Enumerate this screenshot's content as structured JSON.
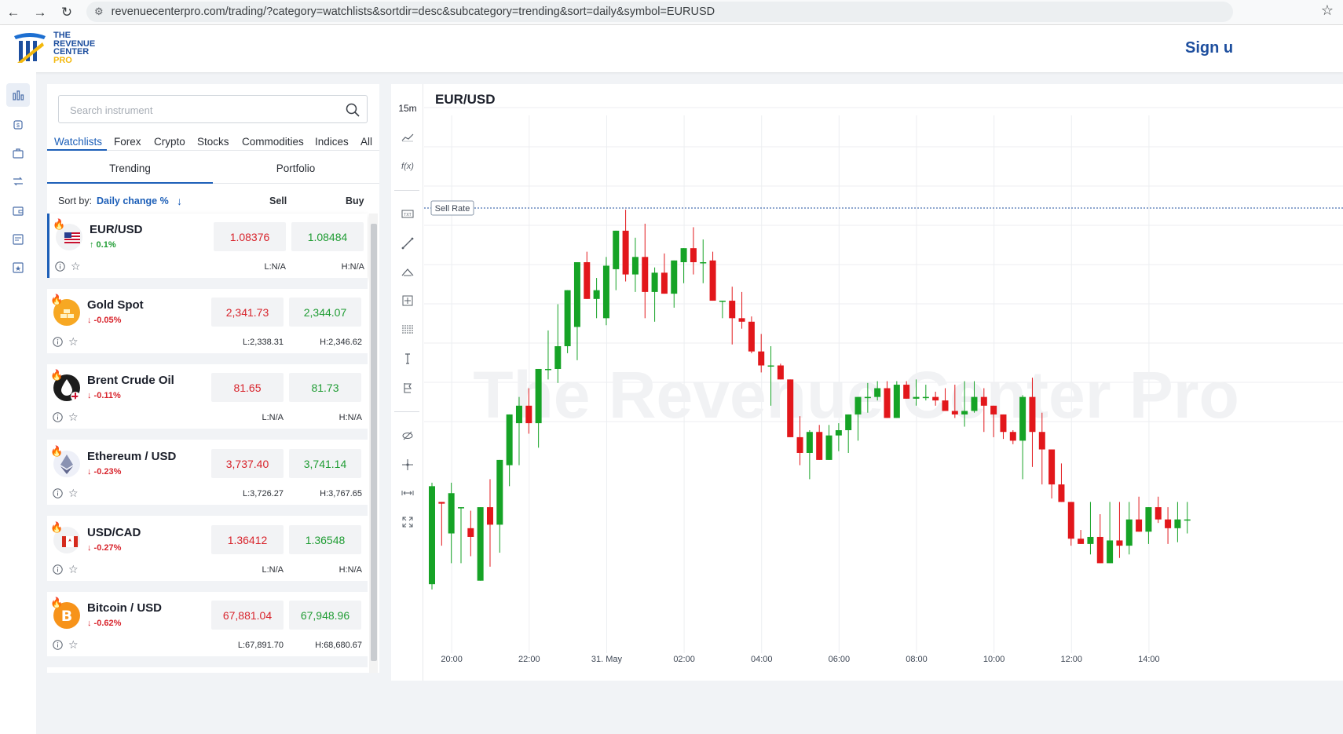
{
  "browser": {
    "url": "revenuecenterpro.com/trading/?category=watchlists&sortdir=desc&subcategory=trending&sort=daily&symbol=EURUSD"
  },
  "header": {
    "logo_lines": [
      "THE",
      "REVENUE",
      "CENTER",
      "PRO"
    ],
    "sign_in": "Sign u"
  },
  "rail": {
    "icons": [
      "chart-bars-icon",
      "money-bag-icon",
      "briefcase-icon",
      "transfer-icon",
      "wallet-icon",
      "news-icon",
      "star-box-icon"
    ]
  },
  "panel": {
    "search_placeholder": "Search instrument",
    "category_tabs": [
      "Watchlists",
      "Forex",
      "Crypto",
      "Stocks",
      "Commodities",
      "Indices",
      "All"
    ],
    "active_category": "Watchlists",
    "sub_tabs": [
      "Trending",
      "Portfolio"
    ],
    "active_sub_tab": "Trending",
    "sort_label": "Sort by:",
    "sort_value": "Daily change %",
    "sort_arrow": "↓",
    "sell_header": "Sell",
    "buy_header": "Buy",
    "instruments": [
      {
        "name": "EUR/USD",
        "change": "↑ 0.1%",
        "direction": "up",
        "sell": "1.08376",
        "buy": "1.08484",
        "low": "L:N/A",
        "high": "H:N/A",
        "icon": "eur-usd-flag-icon",
        "active": true
      },
      {
        "name": "Gold Spot",
        "change": "↓ -0.05%",
        "direction": "down",
        "sell": "2,341.73",
        "buy": "2,344.07",
        "low": "L:2,338.31",
        "high": "H:2,346.62",
        "icon": "gold-bars-icon",
        "active": false
      },
      {
        "name": "Brent Crude Oil",
        "change": "↓ -0.11%",
        "direction": "down",
        "sell": "81.65",
        "buy": "81.73",
        "low": "L:N/A",
        "high": "H:N/A",
        "icon": "oil-drop-icon",
        "active": false
      },
      {
        "name": "Ethereum / USD",
        "change": "↓ -0.23%",
        "direction": "down",
        "sell": "3,737.40",
        "buy": "3,741.14",
        "low": "L:3,726.27",
        "high": "H:3,767.65",
        "icon": "ethereum-icon",
        "active": false
      },
      {
        "name": "USD/CAD",
        "change": "↓ -0.27%",
        "direction": "down",
        "sell": "1.36412",
        "buy": "1.36548",
        "low": "L:N/A",
        "high": "H:N/A",
        "icon": "usd-cad-flag-icon",
        "active": false
      },
      {
        "name": "Bitcoin / USD",
        "change": "↓ -0.62%",
        "direction": "down",
        "sell": "67,881.04",
        "buy": "67,948.96",
        "low": "L:67,891.70",
        "high": "H:68,680.67",
        "icon": "bitcoin-icon",
        "active": false
      }
    ]
  },
  "chart": {
    "interval": "15m",
    "symbol": "EUR/USD",
    "sell_rate_label": "Sell Rate",
    "watermark": "The Revenue Center Pro",
    "tools": [
      "line-type-icon",
      "fx-indicator-icon",
      "text-tool-icon",
      "trend-line-icon",
      "channel-tool-icon",
      "crosshair-box-icon",
      "fibonacci-icon",
      "vertical-line-icon",
      "flag-tool-icon",
      "hide-icon",
      "cursor-icon",
      "measure-icon",
      "fullscreen-icon"
    ],
    "x_ticks": [
      "20:00",
      "22:00",
      "31. May",
      "02:00",
      "04:00",
      "06:00",
      "08:00",
      "10:00",
      "12:00",
      "14:00"
    ],
    "colors": {
      "up": "#16a326",
      "down": "#e2171b",
      "grid": "#eceef1",
      "accent": "#1d5fb8"
    }
  },
  "chart_data": {
    "type": "candlestick",
    "title": "EUR/USD",
    "x": [
      "19:30",
      "19:45",
      "20:00",
      "20:15",
      "20:30",
      "20:45",
      "21:00",
      "21:15",
      "21:30",
      "21:45",
      "22:00",
      "22:15",
      "22:30",
      "22:45",
      "23:00",
      "23:15",
      "23:30",
      "23:45",
      "00:00",
      "00:15",
      "00:30",
      "00:45",
      "01:00",
      "01:15",
      "01:30",
      "01:45",
      "02:00",
      "02:15",
      "02:30",
      "02:45",
      "03:00",
      "03:15",
      "03:30",
      "03:45",
      "04:00",
      "04:15",
      "04:30",
      "04:45",
      "05:00",
      "05:15",
      "05:30",
      "05:45",
      "06:00",
      "06:15",
      "06:30",
      "06:45",
      "07:00",
      "07:15",
      "07:30",
      "07:45",
      "08:00",
      "08:15",
      "08:30",
      "08:45",
      "09:00",
      "09:15",
      "09:30",
      "09:45",
      "10:00",
      "10:15",
      "10:30",
      "10:45",
      "11:00",
      "11:15",
      "11:30",
      "11:45",
      "12:00",
      "12:15",
      "12:30",
      "12:45",
      "13:00",
      "13:15",
      "13:30",
      "13:45",
      "14:00",
      "14:15",
      "14:30",
      "14:45",
      "15:00"
    ],
    "candles": [
      {
        "o": 8,
        "h": 66,
        "l": 5,
        "c": 64
      },
      {
        "o": 55,
        "h": 54,
        "l": 30,
        "c": 54
      },
      {
        "o": 37,
        "h": 66,
        "l": 20,
        "c": 60
      },
      {
        "o": 52,
        "h": 47,
        "l": 20,
        "c": 52
      },
      {
        "o": 40,
        "h": 50,
        "l": 24,
        "c": 35
      },
      {
        "o": 10,
        "h": 44,
        "l": 18,
        "c": 52
      },
      {
        "o": 52,
        "h": 68,
        "l": 18,
        "c": 42
      },
      {
        "o": 42,
        "h": 71,
        "l": 26,
        "c": 79
      },
      {
        "o": 76,
        "h": 100,
        "l": 64,
        "c": 105
      },
      {
        "o": 100,
        "h": 115,
        "l": 76,
        "c": 110
      },
      {
        "o": 110,
        "h": 120,
        "l": 94,
        "c": 100
      },
      {
        "o": 100,
        "h": 131,
        "l": 86,
        "c": 131
      },
      {
        "o": 131,
        "h": 153,
        "l": 125,
        "c": 131
      },
      {
        "o": 131,
        "h": 168,
        "l": 123,
        "c": 144
      },
      {
        "o": 144,
        "h": 172,
        "l": 140,
        "c": 176
      },
      {
        "o": 155,
        "h": 176,
        "l": 136,
        "c": 192
      },
      {
        "o": 192,
        "h": 198,
        "l": 180,
        "c": 171
      },
      {
        "o": 171,
        "h": 183,
        "l": 160,
        "c": 176
      },
      {
        "o": 160,
        "h": 195,
        "l": 156,
        "c": 190
      },
      {
        "o": 188,
        "h": 200,
        "l": 176,
        "c": 210
      },
      {
        "o": 210,
        "h": 222,
        "l": 181,
        "c": 185
      },
      {
        "o": 185,
        "h": 206,
        "l": 175,
        "c": 195
      },
      {
        "o": 195,
        "h": 214,
        "l": 160,
        "c": 175
      },
      {
        "o": 175,
        "h": 189,
        "l": 158,
        "c": 186
      },
      {
        "o": 186,
        "h": 197,
        "l": 174,
        "c": 174
      },
      {
        "o": 174,
        "h": 183,
        "l": 166,
        "c": 193
      },
      {
        "o": 192,
        "h": 200,
        "l": 180,
        "c": 200
      },
      {
        "o": 200,
        "h": 212,
        "l": 185,
        "c": 192
      },
      {
        "o": 192,
        "h": 205,
        "l": 180,
        "c": 192
      },
      {
        "o": 193,
        "h": 198,
        "l": 172,
        "c": 170
      },
      {
        "o": 170,
        "h": 170,
        "l": 160,
        "c": 170
      },
      {
        "o": 170,
        "h": 178,
        "l": 145,
        "c": 160
      },
      {
        "o": 160,
        "h": 175,
        "l": 154,
        "c": 158
      },
      {
        "o": 158,
        "h": 161,
        "l": 140,
        "c": 141
      },
      {
        "o": 141,
        "h": 151,
        "l": 129,
        "c": 133
      },
      {
        "o": 133,
        "h": 144,
        "l": 110,
        "c": 133
      },
      {
        "o": 133,
        "h": 134,
        "l": 126,
        "c": 125
      },
      {
        "o": 125,
        "h": 105,
        "l": 100,
        "c": 92
      },
      {
        "o": 92,
        "h": 104,
        "l": 76,
        "c": 83
      },
      {
        "o": 83,
        "h": 96,
        "l": 68,
        "c": 95
      },
      {
        "o": 95,
        "h": 99,
        "l": 83,
        "c": 79
      },
      {
        "o": 79,
        "h": 99,
        "l": 81,
        "c": 93
      },
      {
        "o": 93,
        "h": 100,
        "l": 84,
        "c": 96
      },
      {
        "o": 96,
        "h": 104,
        "l": 83,
        "c": 105
      },
      {
        "o": 105,
        "h": 115,
        "l": 90,
        "c": 115
      },
      {
        "o": 115,
        "h": 123,
        "l": 106,
        "c": 115
      },
      {
        "o": 115,
        "h": 124,
        "l": 113,
        "c": 120
      },
      {
        "o": 120,
        "h": 124,
        "l": 106,
        "c": 103
      },
      {
        "o": 103,
        "h": 124,
        "l": 108,
        "c": 122
      },
      {
        "o": 122,
        "h": 124,
        "l": 116,
        "c": 114
      },
      {
        "o": 114,
        "h": 125,
        "l": 110,
        "c": 115
      },
      {
        "o": 115,
        "h": 122,
        "l": 113,
        "c": 115
      },
      {
        "o": 115,
        "h": 118,
        "l": 110,
        "c": 113
      },
      {
        "o": 113,
        "h": 120,
        "l": 109,
        "c": 107
      },
      {
        "o": 107,
        "h": 122,
        "l": 103,
        "c": 105
      },
      {
        "o": 105,
        "h": 124,
        "l": 98,
        "c": 107
      },
      {
        "o": 107,
        "h": 124,
        "l": 106,
        "c": 115
      },
      {
        "o": 115,
        "h": 120,
        "l": 95,
        "c": 110
      },
      {
        "o": 110,
        "h": 107,
        "l": 92,
        "c": 105
      },
      {
        "o": 105,
        "h": 97,
        "l": 91,
        "c": 95
      },
      {
        "o": 95,
        "h": 96,
        "l": 88,
        "c": 90
      },
      {
        "o": 90,
        "h": 116,
        "l": 68,
        "c": 115
      },
      {
        "o": 115,
        "h": 126,
        "l": 75,
        "c": 95
      },
      {
        "o": 95,
        "h": 106,
        "l": 65,
        "c": 85
      },
      {
        "o": 85,
        "h": 70,
        "l": 57,
        "c": 65
      },
      {
        "o": 65,
        "h": 77,
        "l": 55,
        "c": 55
      },
      {
        "o": 55,
        "h": 42,
        "l": 30,
        "c": 34
      },
      {
        "o": 34,
        "h": 39,
        "l": 31,
        "c": 31
      },
      {
        "o": 31,
        "h": 55,
        "l": 25,
        "c": 35
      },
      {
        "o": 35,
        "h": 48,
        "l": 20,
        "c": 20
      },
      {
        "o": 20,
        "h": 55,
        "l": 25,
        "c": 33
      },
      {
        "o": 33,
        "h": 55,
        "l": 23,
        "c": 30
      },
      {
        "o": 30,
        "h": 55,
        "l": 25,
        "c": 45
      },
      {
        "o": 45,
        "h": 58,
        "l": 39,
        "c": 38
      },
      {
        "o": 38,
        "h": 52,
        "l": 31,
        "c": 52
      },
      {
        "o": 52,
        "h": 58,
        "l": 43,
        "c": 45
      },
      {
        "o": 45,
        "h": 52,
        "l": 31,
        "c": 40
      },
      {
        "o": 40,
        "h": 55,
        "l": 32,
        "c": 45
      },
      {
        "o": 45,
        "h": 55,
        "l": 37,
        "c": 45
      }
    ],
    "xlabel": "",
    "ylabel": "",
    "grid": true
  }
}
